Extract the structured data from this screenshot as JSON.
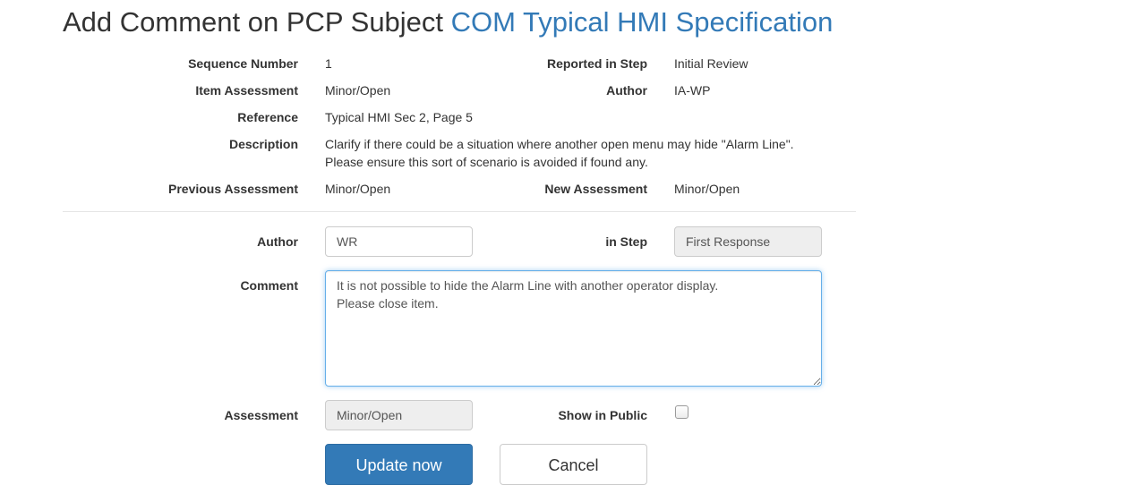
{
  "header": {
    "prefix": "Add Comment on PCP Subject",
    "subject_link": "COM Typical HMI Specification"
  },
  "details": {
    "sequence_number_label": "Sequence Number",
    "sequence_number": "1",
    "reported_in_step_label": "Reported in Step",
    "reported_in_step": "Initial Review",
    "item_assessment_label": "Item Assessment",
    "item_assessment": "Minor/Open",
    "author_label": "Author",
    "author": "IA-WP",
    "reference_label": "Reference",
    "reference": "Typical HMI Sec 2, Page 5",
    "description_label": "Description",
    "description": "Clarify if there could be a situation where another open menu may hide \"Alarm Line\". Please ensure this sort of scenario is avoided if found any.",
    "previous_assessment_label": "Previous Assessment",
    "previous_assessment": "Minor/Open",
    "new_assessment_label": "New Assessment",
    "new_assessment": "Minor/Open"
  },
  "form": {
    "author_label": "Author",
    "author_value": "WR",
    "in_step_label": "in Step",
    "in_step_value": "First Response",
    "comment_label": "Comment",
    "comment_value": "It is not possible to hide the Alarm Line with another operator display.\nPlease close item.",
    "assessment_label": "Assessment",
    "assessment_value": "Minor/Open",
    "show_in_public_label": "Show in Public",
    "show_in_public_checked": false,
    "update_button": "Update now",
    "cancel_button": "Cancel"
  },
  "colors": {
    "link": "#337ab7",
    "primary_button": "#337ab7",
    "focus_border": "#66afe9"
  }
}
